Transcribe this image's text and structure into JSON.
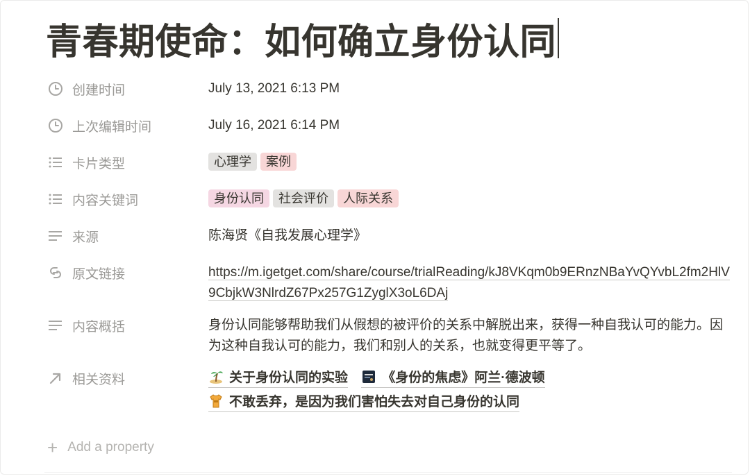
{
  "page": {
    "title": "青春期使命：如何确立身份认同"
  },
  "properties": {
    "created": {
      "label": "创建时间",
      "icon": "clock-icon",
      "value": "July 13, 2021 6:13 PM"
    },
    "edited": {
      "label": "上次编辑时间",
      "icon": "clock-icon",
      "value": "July 16, 2021 6:14 PM"
    },
    "card_type": {
      "label": "卡片类型",
      "icon": "list-icon",
      "tags": [
        {
          "text": "心理学",
          "color": "#e3e2e0"
        },
        {
          "text": "案例",
          "color": "#f8d6d6"
        }
      ]
    },
    "keywords": {
      "label": "内容关键词",
      "icon": "list-icon",
      "tags": [
        {
          "text": "身份认同",
          "color": "#f5d7e3"
        },
        {
          "text": "社会评价",
          "color": "#e3e2e0"
        },
        {
          "text": "人际关系",
          "color": "#f8d6d6"
        }
      ]
    },
    "source": {
      "label": "来源",
      "icon": "text-lines-icon",
      "value": "陈海贤《自我发展心理学》"
    },
    "link": {
      "label": "原文链接",
      "icon": "link-icon",
      "value": "https://m.igetget.com/share/course/trialReading/kJ8VKqm0b9ERnzNBaYvQYvbL2fm2HlV9CbjkW3NlrdZ67Px257G1ZyglX3oL6DAj"
    },
    "summary": {
      "label": "内容概括",
      "icon": "text-lines-icon",
      "value": "身份认同能够帮助我们从假想的被评价的关系中解脱出来，获得一种自我认可的能力。因为这种自我认可的能力，我们和别人的关系，也就变得更平等了。"
    },
    "related": {
      "label": "相关资料",
      "icon": "arrow-up-right-icon",
      "items": [
        {
          "text": "关于身份认同的实验",
          "icon": "island-icon"
        },
        {
          "text": "《身份的焦虑》阿兰·德波顿",
          "icon": "book-cover-icon"
        },
        {
          "text": "不敢丢弃，是因为我们害怕失去对自己身份的认同",
          "icon": "shirt-icon"
        }
      ]
    }
  },
  "add_property": {
    "label": "Add a property",
    "icon": "plus-icon"
  },
  "colors": {
    "text": "#37352f",
    "muted": "#9b9a97",
    "tag_gray": "#e3e2e0",
    "tag_pink": "#f5d7e3",
    "tag_red": "#f8d6d6"
  }
}
